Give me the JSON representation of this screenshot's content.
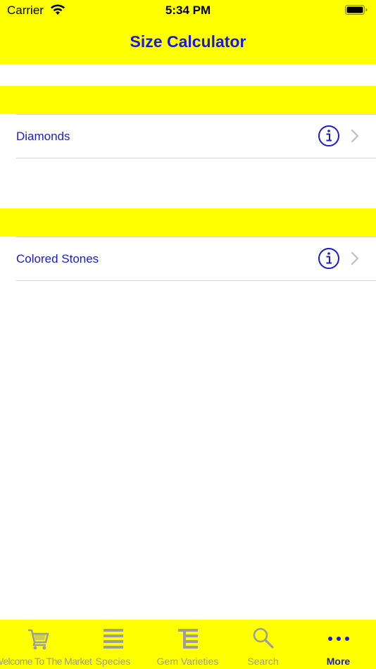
{
  "status_bar": {
    "carrier": "Carrier",
    "time": "5:34 PM"
  },
  "nav": {
    "title": "Size Calculator"
  },
  "sections": [
    {
      "rows": [
        {
          "label": "Diamonds",
          "info_icon": "info-circle-icon",
          "disclosure_icon": "chevron-right-icon"
        }
      ]
    },
    {
      "rows": [
        {
          "label": "Colored Stones",
          "info_icon": "info-circle-icon",
          "disclosure_icon": "chevron-right-icon"
        }
      ]
    }
  ],
  "tab_bar": {
    "tabs": [
      {
        "label": "Welcome To The Market",
        "icon": "cart-icon",
        "active": false
      },
      {
        "label": "Species",
        "icon": "list-icon",
        "active": false
      },
      {
        "label": "Gem Varieties",
        "icon": "varieties-list-icon",
        "active": false
      },
      {
        "label": "Search",
        "icon": "search-icon",
        "active": false
      },
      {
        "label": "More",
        "icon": "more-icon",
        "active": true
      }
    ]
  },
  "colors": {
    "bar_yellow": "#ffff00",
    "accent_blue": "#1a1ad6",
    "inactive_gray": "#9d9d9d"
  }
}
